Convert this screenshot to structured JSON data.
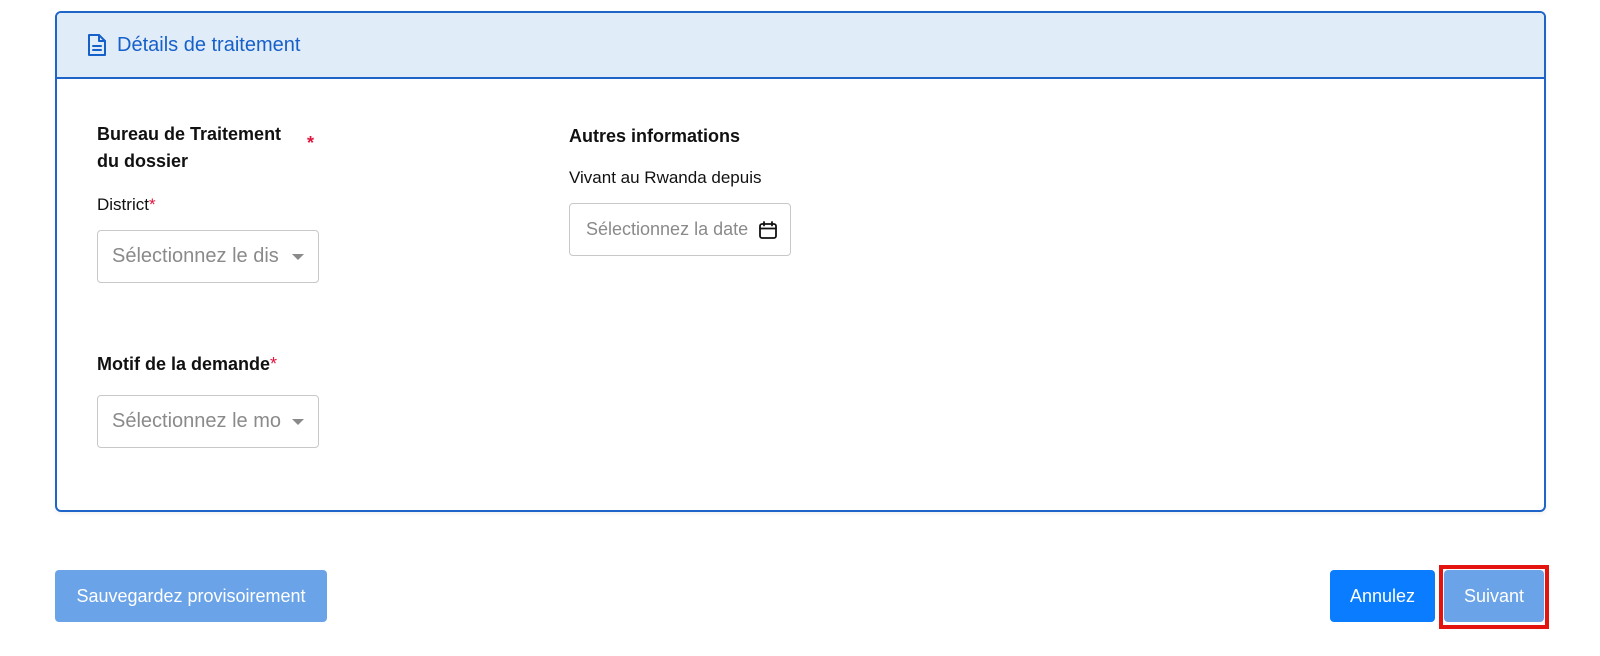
{
  "section": {
    "title": "Détails de traitement",
    "icon": "document-icon"
  },
  "bureau": {
    "label": "Bureau de Traitement du dossier",
    "required_mark": "*"
  },
  "district": {
    "label": "District",
    "required_mark": "*",
    "placeholder": "Sélectionnez le dis"
  },
  "motif": {
    "label": "Motif de la demande",
    "required_mark": "*",
    "placeholder": "Sélectionnez le mo"
  },
  "autres": {
    "label": "Autres informations",
    "vivant_label": "Vivant au Rwanda depuis",
    "date_placeholder": "Sélectionnez la date",
    "icon": "calendar-icon"
  },
  "actions": {
    "save_label": "Sauvegardez provisoirement",
    "cancel_label": "Annulez",
    "next_label": "Suivant"
  },
  "colors": {
    "primary": "#0a7cff",
    "disabled": "#6aa3e8",
    "header_bg": "#e1ecf9",
    "border": "#1f64c8",
    "required": "#e0143c",
    "highlight": "#e3140f"
  }
}
